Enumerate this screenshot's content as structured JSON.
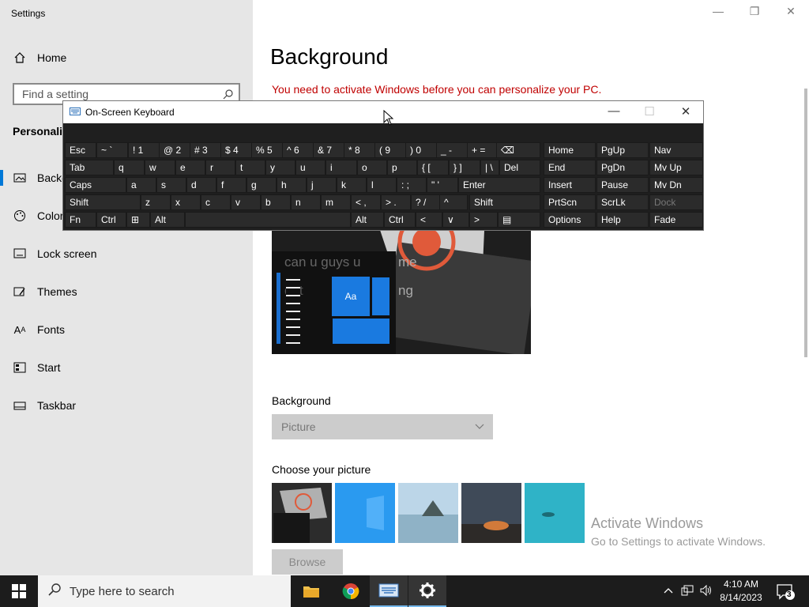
{
  "window": {
    "title": "Settings",
    "controls": {
      "minimize": "—",
      "restore": "❐",
      "close": "✕"
    }
  },
  "sidebar": {
    "home_label": "Home",
    "search_placeholder": "Find a setting",
    "section_heading": "Personaliz",
    "items": [
      {
        "label": "Backg",
        "icon": "picture-icon",
        "active": true
      },
      {
        "label": "Color",
        "icon": "palette-icon",
        "active": false
      },
      {
        "label": "Lock screen",
        "icon": "lock-screen-icon",
        "active": false
      },
      {
        "label": "Themes",
        "icon": "brush-icon",
        "active": false
      },
      {
        "label": "Fonts",
        "icon": "font-icon",
        "active": false
      },
      {
        "label": "Start",
        "icon": "start-layout-icon",
        "active": false
      },
      {
        "label": "Taskbar",
        "icon": "taskbar-icon",
        "active": false
      }
    ]
  },
  "main": {
    "title": "Background",
    "warning": "You need to activate Windows before you can personalize your PC.",
    "preview": {
      "overlay_text_1": "can u guys u",
      "overlay_text_2": "me",
      "overlay_text_3": "dnt",
      "overlay_text_4": "ng",
      "tile_label": "Aa"
    },
    "background_label": "Background",
    "background_value": "Picture",
    "choose_label": "Choose your picture",
    "browse_label": "Browse",
    "watermark_line1": "Activate Windows",
    "watermark_line2": "Go to Settings to activate Windows."
  },
  "osk": {
    "title": "On-Screen Keyboard",
    "controls": {
      "minimize": "—",
      "maximize": "☐",
      "close": "✕"
    },
    "rows": [
      [
        {
          "label": "Esc"
        },
        {
          "label": "~ `"
        },
        {
          "label": "! 1"
        },
        {
          "label": "@ 2"
        },
        {
          "label": "# 3"
        },
        {
          "label": "$ 4"
        },
        {
          "label": "% 5"
        },
        {
          "label": "^ 6"
        },
        {
          "label": "& 7"
        },
        {
          "label": "* 8"
        },
        {
          "label": "( 9"
        },
        {
          "label": ") 0"
        },
        {
          "label": "_ -"
        },
        {
          "label": "+ ="
        },
        {
          "label": "⌫"
        },
        {
          "label": "Home"
        },
        {
          "label": "PgUp"
        },
        {
          "label": "Nav"
        }
      ],
      [
        {
          "label": "Tab"
        },
        {
          "label": "q"
        },
        {
          "label": "w"
        },
        {
          "label": "e"
        },
        {
          "label": "r"
        },
        {
          "label": "t"
        },
        {
          "label": "y"
        },
        {
          "label": "u"
        },
        {
          "label": "i"
        },
        {
          "label": "o"
        },
        {
          "label": "p"
        },
        {
          "label": "{ ["
        },
        {
          "label": "} ]"
        },
        {
          "label": "| \\"
        },
        {
          "label": "Del"
        },
        {
          "label": "End"
        },
        {
          "label": "PgDn"
        },
        {
          "label": "Mv Up"
        }
      ],
      [
        {
          "label": "Caps"
        },
        {
          "label": "a"
        },
        {
          "label": "s"
        },
        {
          "label": "d"
        },
        {
          "label": "f"
        },
        {
          "label": "g"
        },
        {
          "label": "h"
        },
        {
          "label": "j"
        },
        {
          "label": "k"
        },
        {
          "label": "l"
        },
        {
          "label": ": ;"
        },
        {
          "label": "\" '"
        },
        {
          "label": "Enter"
        },
        {
          "label": "Insert"
        },
        {
          "label": "Pause"
        },
        {
          "label": "Mv Dn"
        }
      ],
      [
        {
          "label": "Shift"
        },
        {
          "label": "z"
        },
        {
          "label": "x"
        },
        {
          "label": "c"
        },
        {
          "label": "v"
        },
        {
          "label": "b"
        },
        {
          "label": "n"
        },
        {
          "label": "m"
        },
        {
          "label": "< ,"
        },
        {
          "label": "> ."
        },
        {
          "label": "? /"
        },
        {
          "label": "^"
        },
        {
          "label": "Shift"
        },
        {
          "label": "PrtScn"
        },
        {
          "label": "ScrLk"
        },
        {
          "label": "Dock"
        }
      ],
      [
        {
          "label": "Fn"
        },
        {
          "label": "Ctrl"
        },
        {
          "label": "⊞"
        },
        {
          "label": "Alt"
        },
        {
          "label": ""
        },
        {
          "label": "Alt"
        },
        {
          "label": "Ctrl"
        },
        {
          "label": "<"
        },
        {
          "label": "∨"
        },
        {
          "label": ">"
        },
        {
          "label": "▤"
        },
        {
          "label": "Options"
        },
        {
          "label": "Help"
        },
        {
          "label": "Fade"
        }
      ]
    ]
  },
  "taskbar": {
    "search_placeholder": "Type here to search",
    "apps": [
      {
        "name": "file-explorer",
        "active": false
      },
      {
        "name": "chrome",
        "active": false
      },
      {
        "name": "on-screen-keyboard",
        "active": true
      },
      {
        "name": "settings",
        "active": true
      }
    ],
    "time": "4:10 AM",
    "date": "8/14/2023",
    "notification_count": "3",
    "accent": "#0078d7"
  }
}
